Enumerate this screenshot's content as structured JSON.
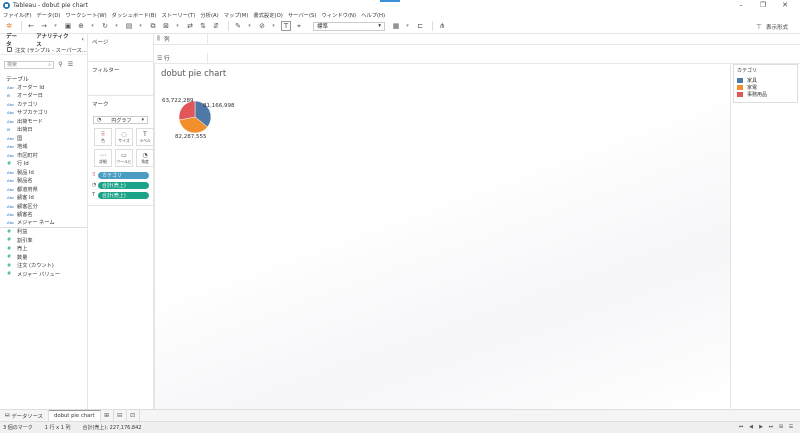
{
  "window": {
    "title": "Tableau - dobut pie chart",
    "minimize": "–",
    "maximize": "❐",
    "close": "✕"
  },
  "menu": [
    "ファイル(F)",
    "データ(D)",
    "ワークシート(W)",
    "ダッシュボード(B)",
    "ストーリー(T)",
    "分析(A)",
    "マップ(M)",
    "書式設定(O)",
    "サーバー(S)",
    "ウィンドウ(N)",
    "ヘルプ(H)"
  ],
  "toolbar": {
    "fit_value": "標準",
    "show_me": "表示形式"
  },
  "left_panel": {
    "tab_data": "データ",
    "tab_analytics": "アナリティクス",
    "collapse": "‹",
    "datasource": "注文 (サンプル - スーパース...",
    "search_placeholder": "検索",
    "tables_label": "テーブル",
    "fields": [
      {
        "type": "Abc",
        "name": "オーダー Id"
      },
      {
        "type": "⊟",
        "name": "オーダー日"
      },
      {
        "type": "Abc",
        "name": "カテゴリ"
      },
      {
        "type": "Abc",
        "name": "サブカテゴリ"
      },
      {
        "type": "Abc",
        "name": "出荷モード"
      },
      {
        "type": "⊟",
        "name": "出荷日"
      },
      {
        "type": "Abc",
        "name": "国"
      },
      {
        "type": "Abc",
        "name": "地域"
      },
      {
        "type": "Abc",
        "name": "市区町村"
      },
      {
        "type": "#",
        "name": "行 Id"
      },
      {
        "type": "Abc",
        "name": "製品 Id"
      },
      {
        "type": "Abc",
        "name": "製品名"
      },
      {
        "type": "Abc",
        "name": "都道府県"
      },
      {
        "type": "Abc",
        "name": "顧客 Id"
      },
      {
        "type": "Abc",
        "name": "顧客区分"
      },
      {
        "type": "Abc",
        "name": "顧客名"
      },
      {
        "type": "Abc",
        "name": "メジャー ネーム"
      }
    ],
    "measures": [
      {
        "type": "#",
        "name": "利益"
      },
      {
        "type": "#",
        "name": "割引率"
      },
      {
        "type": "#",
        "name": "売上"
      },
      {
        "type": "#",
        "name": "数量"
      },
      {
        "type": "#",
        "name": "注文 (カウント)"
      },
      {
        "type": "#",
        "name": "メジャー バリュー"
      }
    ]
  },
  "cards": {
    "pages": "ページ",
    "filters": "フィルター",
    "marks": "マーク",
    "marks_type": "円グラフ",
    "mark_buttons": [
      {
        "glyph": "⠿",
        "label": "色"
      },
      {
        "glyph": "◌",
        "label": "サイズ"
      },
      {
        "glyph": "T",
        "label": "ラベル"
      },
      {
        "glyph": "⋯",
        "label": "詳細"
      },
      {
        "glyph": "▭",
        "label": "ツールヒ"
      },
      {
        "glyph": "◔",
        "label": "角度"
      }
    ],
    "mark_pills": [
      {
        "icon": "⠿",
        "label": "カテゴリ",
        "kind": "dim"
      },
      {
        "icon": "◔",
        "label": "合計(売上)",
        "kind": "meas"
      },
      {
        "icon": "T",
        "label": "合計(売上)",
        "kind": "meas"
      }
    ]
  },
  "shelves": {
    "columns": "列",
    "rows": "行"
  },
  "sheet_title": "dobut pie chart",
  "chart_data": {
    "type": "pie",
    "title": "dobut pie chart",
    "legend_title": "カテゴリ",
    "legend_position": "right",
    "slices": [
      {
        "name": "家具",
        "value": 81166998,
        "label": "81,166,998",
        "color": "#4e79a7"
      },
      {
        "name": "家電",
        "value": 82287555,
        "label": "82,287,555",
        "color": "#f28e2b"
      },
      {
        "name": "事務用品",
        "value": 63722289,
        "label": "63,722,289",
        "color": "#e15759"
      }
    ]
  },
  "bottom_tabs": {
    "datasource": "データソース",
    "sheet": "dobut pie chart"
  },
  "status": {
    "marks": "3 個のマーク",
    "rows_cols": "1 行 x 1 列",
    "sum": "合計(売上): 227,176,842"
  }
}
